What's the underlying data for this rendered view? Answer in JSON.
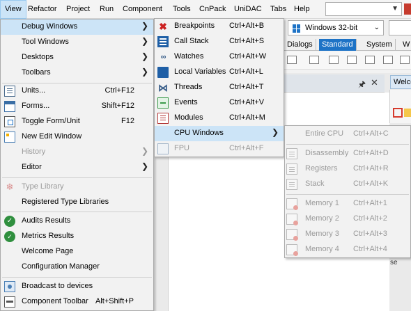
{
  "menubar": {
    "items": [
      "View",
      "Refactor",
      "Project",
      "Run",
      "Component",
      "Tools",
      "CnPack",
      "UniDAC",
      "Tabs",
      "Help"
    ]
  },
  "toolbar": {
    "platform": "Windows 32-bit"
  },
  "palette": {
    "tabs": [
      "Dialogs",
      "Standard",
      "System",
      "W"
    ]
  },
  "welcome_tab": "Welco",
  "welcome_fragment": "se",
  "view_menu": {
    "items": [
      {
        "label": "Debug Windows",
        "submenu": true
      },
      {
        "label": "Tool Windows",
        "submenu": true
      },
      {
        "label": "Desktops",
        "submenu": true
      },
      {
        "label": "Toolbars",
        "submenu": true
      },
      {
        "label": "Units...",
        "shortcut": "Ctrl+F12"
      },
      {
        "label": "Forms...",
        "shortcut": "Shift+F12"
      },
      {
        "label": "Toggle Form/Unit",
        "shortcut": "F12"
      },
      {
        "label": "New Edit Window"
      },
      {
        "label": "History",
        "submenu": true
      },
      {
        "label": "Editor",
        "submenu": true
      },
      {
        "label": "Type Library"
      },
      {
        "label": "Registered Type Libraries"
      },
      {
        "label": "Audits Results"
      },
      {
        "label": "Metrics Results"
      },
      {
        "label": "Welcome Page"
      },
      {
        "label": "Configuration Manager"
      },
      {
        "label": "Broadcast to devices"
      },
      {
        "label": "Component Toolbar",
        "shortcut": "Alt+Shift+P"
      }
    ]
  },
  "debug_menu": {
    "items": [
      {
        "label": "Breakpoints",
        "shortcut": "Ctrl+Alt+B"
      },
      {
        "label": "Call Stack",
        "shortcut": "Ctrl+Alt+S"
      },
      {
        "label": "Watches",
        "shortcut": "Ctrl+Alt+W"
      },
      {
        "label": "Local Variables",
        "shortcut": "Ctrl+Alt+L"
      },
      {
        "label": "Threads",
        "shortcut": "Ctrl+Alt+T"
      },
      {
        "label": "Events",
        "shortcut": "Ctrl+Alt+V"
      },
      {
        "label": "Modules",
        "shortcut": "Ctrl+Alt+M"
      },
      {
        "label": "CPU Windows",
        "submenu": true
      },
      {
        "label": "FPU",
        "shortcut": "Ctrl+Alt+F"
      }
    ]
  },
  "cpu_menu": {
    "items": [
      {
        "label": "Entire CPU",
        "shortcut": "Ctrl+Alt+C"
      },
      {
        "label": "Disassembly",
        "shortcut": "Ctrl+Alt+D"
      },
      {
        "label": "Registers",
        "shortcut": "Ctrl+Alt+R"
      },
      {
        "label": "Stack",
        "shortcut": "Ctrl+Alt+K"
      },
      {
        "label": "Memory 1",
        "shortcut": "Ctrl+Alt+1"
      },
      {
        "label": "Memory 2",
        "shortcut": "Ctrl+Alt+2"
      },
      {
        "label": "Memory 3",
        "shortcut": "Ctrl+Alt+3"
      },
      {
        "label": "Memory 4",
        "shortcut": "Ctrl+Alt+4"
      }
    ]
  }
}
